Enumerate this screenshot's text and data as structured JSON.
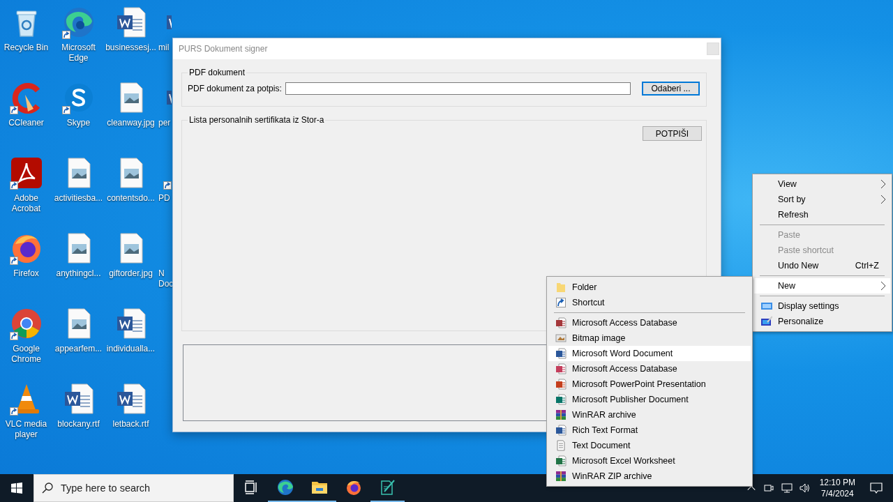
{
  "desktop": {
    "icons": [
      {
        "label": "Recycle Bin",
        "kind": "recycle",
        "shortcut": false
      },
      {
        "label": "CCleaner",
        "kind": "ccleaner",
        "shortcut": true
      },
      {
        "label": "Adobe Acrobat",
        "kind": "acrobat",
        "shortcut": true
      },
      {
        "label": "Firefox",
        "kind": "firefox",
        "shortcut": true
      },
      {
        "label": "Google Chrome",
        "kind": "chrome",
        "shortcut": true
      },
      {
        "label": "VLC media player",
        "kind": "vlc",
        "shortcut": true
      },
      {
        "label": "Microsoft Edge",
        "kind": "edge",
        "shortcut": true
      },
      {
        "label": "Skype",
        "kind": "skype",
        "shortcut": true
      },
      {
        "label": "activitiesba...",
        "kind": "image",
        "shortcut": false
      },
      {
        "label": "anythingcl...",
        "kind": "image",
        "shortcut": false
      },
      {
        "label": "appearfem...",
        "kind": "image",
        "shortcut": false
      },
      {
        "label": "blockany.rtf",
        "kind": "word",
        "shortcut": false
      },
      {
        "label": "businessesj...",
        "kind": "word",
        "shortcut": false
      },
      {
        "label": "cleanway.jpg",
        "kind": "image",
        "shortcut": false
      },
      {
        "label": "contentsdo...",
        "kind": "image",
        "shortcut": false
      },
      {
        "label": "giftorder.jpg",
        "kind": "image",
        "shortcut": false
      },
      {
        "label": "individualla...",
        "kind": "word",
        "shortcut": false
      },
      {
        "label": "letback.rtf",
        "kind": "word",
        "shortcut": false
      },
      {
        "label": "mil",
        "kind": "word",
        "shortcut": false,
        "clipped": true
      },
      {
        "label": "per",
        "kind": "word",
        "shortcut": false,
        "clipped": true
      },
      {
        "label": "PD",
        "kind": "none",
        "shortcut": true,
        "clipped": true
      },
      {
        "label": "N Doc",
        "kind": "none",
        "shortcut": false,
        "clipped": true
      }
    ]
  },
  "window": {
    "title": "PURS Dokument signer",
    "pdf_group": {
      "title": "PDF dokument",
      "field_label": "PDF dokument za potpis:",
      "browse_button": "Odaberi ..."
    },
    "cert_group": {
      "title": "Lista personalnih sertifikata iz Stor-a",
      "sign_button": "POTPIŠI"
    }
  },
  "context_menu": {
    "items": [
      {
        "kind": "item",
        "label": "View",
        "submenu": true,
        "disabled": false,
        "selected": false
      },
      {
        "kind": "item",
        "label": "Sort by",
        "submenu": true,
        "disabled": false,
        "selected": false
      },
      {
        "kind": "item",
        "label": "Refresh",
        "submenu": false,
        "disabled": false,
        "selected": false
      },
      {
        "kind": "separator"
      },
      {
        "kind": "item",
        "label": "Paste",
        "submenu": false,
        "disabled": true,
        "selected": false
      },
      {
        "kind": "item",
        "label": "Paste shortcut",
        "submenu": false,
        "disabled": true,
        "selected": false
      },
      {
        "kind": "item",
        "label": "Undo New",
        "shortcut": "Ctrl+Z",
        "submenu": false,
        "disabled": false,
        "selected": false
      },
      {
        "kind": "separator"
      },
      {
        "kind": "item",
        "label": "New",
        "submenu": true,
        "disabled": false,
        "selected": true
      },
      {
        "kind": "separator"
      },
      {
        "kind": "display",
        "label": "Display settings",
        "submenu": false,
        "disabled": false,
        "selected": false
      },
      {
        "kind": "personalize",
        "label": "Personalize",
        "submenu": false,
        "disabled": false,
        "selected": false
      }
    ]
  },
  "new_submenu": {
    "items": [
      {
        "kind": "folder",
        "label": "Folder",
        "selected": false
      },
      {
        "kind": "shortcut",
        "label": "Shortcut",
        "selected": false
      },
      {
        "kind": "separator"
      },
      {
        "kind": "access",
        "label": "Microsoft Access Database",
        "selected": false
      },
      {
        "kind": "bitmap",
        "label": "Bitmap image",
        "selected": false
      },
      {
        "kind": "word",
        "label": "Microsoft Word Document",
        "selected": true
      },
      {
        "kind": "access-outline",
        "label": "Microsoft Access Database",
        "selected": false
      },
      {
        "kind": "powerpoint",
        "label": "Microsoft PowerPoint Presentation",
        "selected": false
      },
      {
        "kind": "publisher",
        "label": "Microsoft Publisher Document",
        "selected": false
      },
      {
        "kind": "winrar",
        "label": "WinRAR archive",
        "selected": false
      },
      {
        "kind": "word",
        "label": "Rich Text Format",
        "selected": false
      },
      {
        "kind": "text",
        "label": "Text Document",
        "selected": false
      },
      {
        "kind": "excel",
        "label": "Microsoft Excel Worksheet",
        "selected": false
      },
      {
        "kind": "winrar",
        "label": "WinRAR ZIP archive",
        "selected": false
      }
    ]
  },
  "taskbar": {
    "search": {
      "placeholder": "Type here to search"
    },
    "apps": [
      {
        "kind": "taskview",
        "running": false
      },
      {
        "kind": "edge",
        "running": true
      },
      {
        "kind": "explorer",
        "running": true
      },
      {
        "kind": "firefox",
        "running": false
      },
      {
        "kind": "signer",
        "running": true
      }
    ],
    "time": "12:10 PM",
    "date": "7/4/2024"
  }
}
